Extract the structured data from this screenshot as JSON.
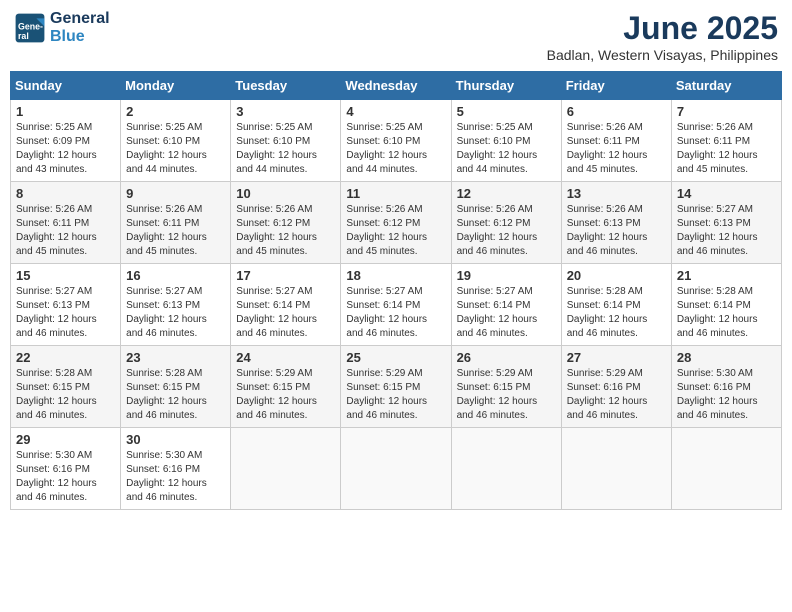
{
  "logo": {
    "line1": "General",
    "line2": "Blue"
  },
  "title": "June 2025",
  "subtitle": "Badlan, Western Visayas, Philippines",
  "weekdays": [
    "Sunday",
    "Monday",
    "Tuesday",
    "Wednesday",
    "Thursday",
    "Friday",
    "Saturday"
  ],
  "weeks": [
    [
      {
        "day": "1",
        "sunrise": "5:25 AM",
        "sunset": "6:09 PM",
        "daylight": "12 hours and 43 minutes."
      },
      {
        "day": "2",
        "sunrise": "5:25 AM",
        "sunset": "6:10 PM",
        "daylight": "12 hours and 44 minutes."
      },
      {
        "day": "3",
        "sunrise": "5:25 AM",
        "sunset": "6:10 PM",
        "daylight": "12 hours and 44 minutes."
      },
      {
        "day": "4",
        "sunrise": "5:25 AM",
        "sunset": "6:10 PM",
        "daylight": "12 hours and 44 minutes."
      },
      {
        "day": "5",
        "sunrise": "5:25 AM",
        "sunset": "6:10 PM",
        "daylight": "12 hours and 44 minutes."
      },
      {
        "day": "6",
        "sunrise": "5:26 AM",
        "sunset": "6:11 PM",
        "daylight": "12 hours and 45 minutes."
      },
      {
        "day": "7",
        "sunrise": "5:26 AM",
        "sunset": "6:11 PM",
        "daylight": "12 hours and 45 minutes."
      }
    ],
    [
      {
        "day": "8",
        "sunrise": "5:26 AM",
        "sunset": "6:11 PM",
        "daylight": "12 hours and 45 minutes."
      },
      {
        "day": "9",
        "sunrise": "5:26 AM",
        "sunset": "6:11 PM",
        "daylight": "12 hours and 45 minutes."
      },
      {
        "day": "10",
        "sunrise": "5:26 AM",
        "sunset": "6:12 PM",
        "daylight": "12 hours and 45 minutes."
      },
      {
        "day": "11",
        "sunrise": "5:26 AM",
        "sunset": "6:12 PM",
        "daylight": "12 hours and 45 minutes."
      },
      {
        "day": "12",
        "sunrise": "5:26 AM",
        "sunset": "6:12 PM",
        "daylight": "12 hours and 46 minutes."
      },
      {
        "day": "13",
        "sunrise": "5:26 AM",
        "sunset": "6:13 PM",
        "daylight": "12 hours and 46 minutes."
      },
      {
        "day": "14",
        "sunrise": "5:27 AM",
        "sunset": "6:13 PM",
        "daylight": "12 hours and 46 minutes."
      }
    ],
    [
      {
        "day": "15",
        "sunrise": "5:27 AM",
        "sunset": "6:13 PM",
        "daylight": "12 hours and 46 minutes."
      },
      {
        "day": "16",
        "sunrise": "5:27 AM",
        "sunset": "6:13 PM",
        "daylight": "12 hours and 46 minutes."
      },
      {
        "day": "17",
        "sunrise": "5:27 AM",
        "sunset": "6:14 PM",
        "daylight": "12 hours and 46 minutes."
      },
      {
        "day": "18",
        "sunrise": "5:27 AM",
        "sunset": "6:14 PM",
        "daylight": "12 hours and 46 minutes."
      },
      {
        "day": "19",
        "sunrise": "5:27 AM",
        "sunset": "6:14 PM",
        "daylight": "12 hours and 46 minutes."
      },
      {
        "day": "20",
        "sunrise": "5:28 AM",
        "sunset": "6:14 PM",
        "daylight": "12 hours and 46 minutes."
      },
      {
        "day": "21",
        "sunrise": "5:28 AM",
        "sunset": "6:14 PM",
        "daylight": "12 hours and 46 minutes."
      }
    ],
    [
      {
        "day": "22",
        "sunrise": "5:28 AM",
        "sunset": "6:15 PM",
        "daylight": "12 hours and 46 minutes."
      },
      {
        "day": "23",
        "sunrise": "5:28 AM",
        "sunset": "6:15 PM",
        "daylight": "12 hours and 46 minutes."
      },
      {
        "day": "24",
        "sunrise": "5:29 AM",
        "sunset": "6:15 PM",
        "daylight": "12 hours and 46 minutes."
      },
      {
        "day": "25",
        "sunrise": "5:29 AM",
        "sunset": "6:15 PM",
        "daylight": "12 hours and 46 minutes."
      },
      {
        "day": "26",
        "sunrise": "5:29 AM",
        "sunset": "6:15 PM",
        "daylight": "12 hours and 46 minutes."
      },
      {
        "day": "27",
        "sunrise": "5:29 AM",
        "sunset": "6:16 PM",
        "daylight": "12 hours and 46 minutes."
      },
      {
        "day": "28",
        "sunrise": "5:30 AM",
        "sunset": "6:16 PM",
        "daylight": "12 hours and 46 minutes."
      }
    ],
    [
      {
        "day": "29",
        "sunrise": "5:30 AM",
        "sunset": "6:16 PM",
        "daylight": "12 hours and 46 minutes."
      },
      {
        "day": "30",
        "sunrise": "5:30 AM",
        "sunset": "6:16 PM",
        "daylight": "12 hours and 46 minutes."
      },
      null,
      null,
      null,
      null,
      null
    ]
  ]
}
